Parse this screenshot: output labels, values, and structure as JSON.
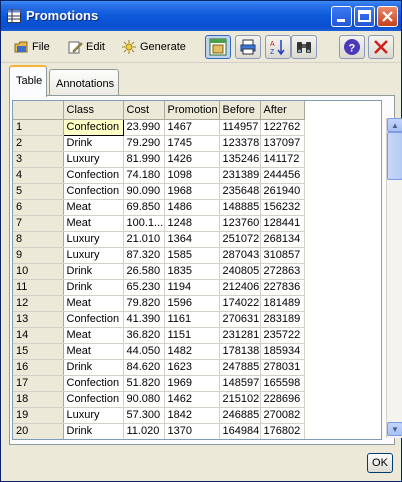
{
  "window": {
    "title": "Promotions"
  },
  "toolbar": {
    "file_label": "File",
    "edit_label": "Edit",
    "generate_label": "Generate"
  },
  "tabs": [
    {
      "label": "Table"
    },
    {
      "label": "Annotations"
    }
  ],
  "table": {
    "columns": [
      "",
      "Class",
      "Cost",
      "Promotion",
      "Before",
      "After"
    ],
    "rows": [
      [
        "1",
        "Confection",
        "23.990",
        "1467",
        "114957",
        "122762"
      ],
      [
        "2",
        "Drink",
        "79.290",
        "1745",
        "123378",
        "137097"
      ],
      [
        "3",
        "Luxury",
        "81.990",
        "1426",
        "135246",
        "141172"
      ],
      [
        "4",
        "Confection",
        "74.180",
        "1098",
        "231389",
        "244456"
      ],
      [
        "5",
        "Confection",
        "90.090",
        "1968",
        "235648",
        "261940"
      ],
      [
        "6",
        "Meat",
        "69.850",
        "1486",
        "148885",
        "156232"
      ],
      [
        "7",
        "Meat",
        "100.1...",
        "1248",
        "123760",
        "128441"
      ],
      [
        "8",
        "Luxury",
        "21.010",
        "1364",
        "251072",
        "268134"
      ],
      [
        "9",
        "Luxury",
        "87.320",
        "1585",
        "287043",
        "310857"
      ],
      [
        "10",
        "Drink",
        "26.580",
        "1835",
        "240805",
        "272863"
      ],
      [
        "11",
        "Drink",
        "65.230",
        "1194",
        "212406",
        "227836"
      ],
      [
        "12",
        "Meat",
        "79.820",
        "1596",
        "174022",
        "181489"
      ],
      [
        "13",
        "Confection",
        "41.390",
        "1161",
        "270631",
        "283189"
      ],
      [
        "14",
        "Meat",
        "36.820",
        "1151",
        "231281",
        "235722"
      ],
      [
        "15",
        "Meat",
        "44.050",
        "1482",
        "178138",
        "185934"
      ],
      [
        "16",
        "Drink",
        "84.620",
        "1623",
        "247885",
        "278031"
      ],
      [
        "17",
        "Confection",
        "51.820",
        "1969",
        "148597",
        "165598"
      ],
      [
        "18",
        "Confection",
        "90.080",
        "1462",
        "215102",
        "228696"
      ],
      [
        "19",
        "Luxury",
        "57.300",
        "1842",
        "246885",
        "270082"
      ],
      [
        "20",
        "Drink",
        "11.020",
        "1370",
        "164984",
        "176802"
      ]
    ]
  },
  "footer": {
    "ok_label": "OK"
  },
  "colors": {
    "titlebar": "#0c5adb",
    "selected_cell": "#ffffc8",
    "active_tab_accent": "#f7b336"
  }
}
